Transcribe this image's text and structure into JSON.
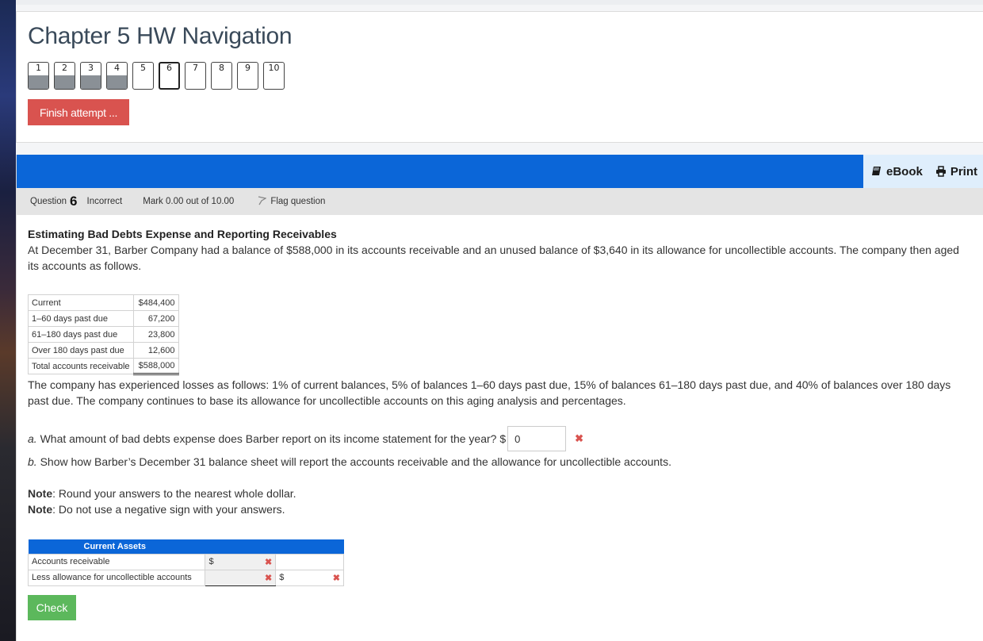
{
  "navigation": {
    "title": "Chapter 5 HW Navigation",
    "questions": [
      {
        "label": "1",
        "answered": true,
        "current": false
      },
      {
        "label": "2",
        "answered": true,
        "current": false
      },
      {
        "label": "3",
        "answered": true,
        "current": false
      },
      {
        "label": "4",
        "answered": true,
        "current": false
      },
      {
        "label": "5",
        "answered": false,
        "current": false
      },
      {
        "label": "6",
        "answered": false,
        "current": true
      },
      {
        "label": "7",
        "answered": false,
        "current": false
      },
      {
        "label": "8",
        "answered": false,
        "current": false
      },
      {
        "label": "9",
        "answered": false,
        "current": false
      },
      {
        "label": "10",
        "answered": false,
        "current": false
      }
    ],
    "finish_label": "Finish attempt ..."
  },
  "tools": {
    "ebook_label": "eBook",
    "print_label": "Print"
  },
  "question_info": {
    "question_prefix": "Question",
    "number": "6",
    "state": "Incorrect",
    "mark": "Mark 0.00 out of 10.00",
    "flag_label": "Flag question"
  },
  "question": {
    "title": "Estimating Bad Debts Expense and Reporting Receivables",
    "intro": "At December 31, Barber Company had a balance of $588,000 in its accounts receivable and an unused balance of $3,640 in its allowance for uncollectible accounts. The company then aged its accounts as follows.",
    "aging": [
      {
        "label": "Current",
        "amount": "$484,400"
      },
      {
        "label": "1–60 days past due",
        "amount": "67,200"
      },
      {
        "label": "61–180 days past due",
        "amount": "23,800"
      },
      {
        "label": "Over 180 days past due",
        "amount": "12,600"
      },
      {
        "label": "Total accounts receivable",
        "amount": "$588,000"
      }
    ],
    "losses_text": "The company has experienced losses as follows: 1% of current balances, 5% of balances 1–60 days past due, 15% of balances 61–180 days past due, and 40% of balances over 180 days past due. The company continues to base its allowance for uncollectible accounts on this aging analysis and percentages.",
    "part_a_prefix": "a.",
    "part_a_text": " What amount of bad debts expense does Barber report on its income statement for the year? $",
    "part_a_value": "0",
    "part_b_prefix": "b.",
    "part_b_text": " Show how Barber’s December 31 balance sheet will report the accounts receivable and the allowance for uncollectible accounts.",
    "note_label": "Note",
    "note1": ": Round your answers to the nearest whole dollar.",
    "note2": ": Do not use a negative sign with your answers.",
    "balance_sheet": {
      "header": "Current Assets",
      "rows": [
        {
          "label": "Accounts receivable",
          "col1_prefix": "$",
          "col1_value": "",
          "col2_prefix": "",
          "col2_value": ""
        },
        {
          "label": "Less allowance for uncollectible accounts",
          "col1_prefix": "",
          "col1_value": "",
          "col2_prefix": "$",
          "col2_value": ""
        }
      ]
    },
    "incorrect_mark": "✖",
    "check_label": "Check"
  }
}
